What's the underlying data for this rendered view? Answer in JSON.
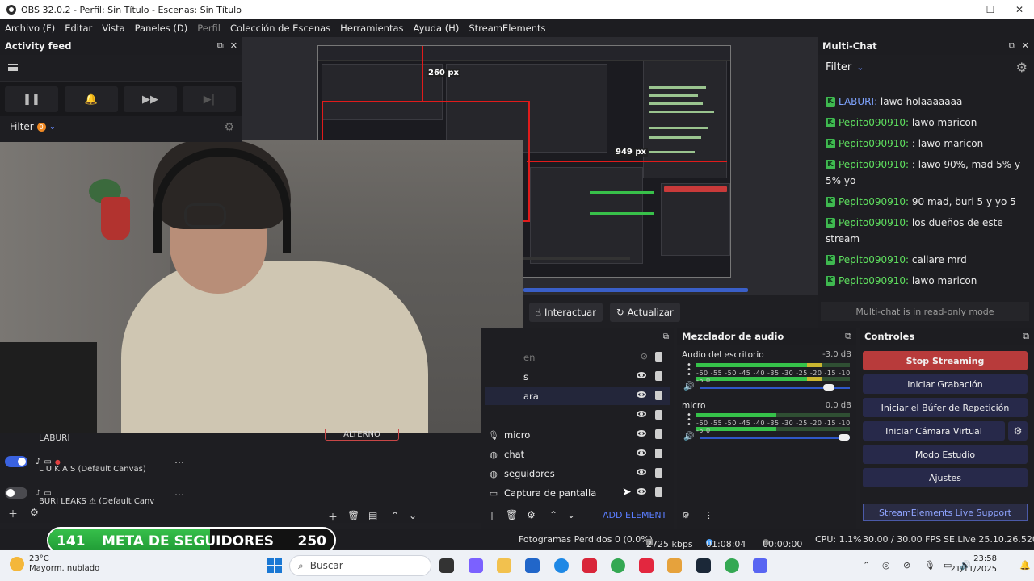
{
  "window": {
    "title": "OBS 32.0.2 - Perfil: Sin Título - Escenas: Sin Título"
  },
  "menu": [
    "Archivo (F)",
    "Editar",
    "Vista",
    "Paneles (D)",
    "Perfil",
    "Colección de Escenas",
    "Herramientas",
    "Ayuda (H)",
    "StreamElements"
  ],
  "activity_feed": {
    "title": "Activity feed",
    "filter_label": "Filter",
    "filter_count": "0"
  },
  "preview": {
    "height_label": "260 px",
    "width_label": "949 px",
    "interact_label": "Interactuar",
    "refresh_label": "Actualizar"
  },
  "multichat": {
    "title": "Multi-Chat",
    "filter_label": "Filter",
    "readonly_text": "Multi-chat is in read-only mode",
    "messages": [
      {
        "user": "LABURI:",
        "text": " lawo holaaaaaaa"
      },
      {
        "user": "Pepito090910:",
        "text": " lawo maricon"
      },
      {
        "user": "Pepito090910:",
        "text": " : lawo maricon"
      },
      {
        "user": "Pepito090910:",
        "text": " : lawo 90%, mad 5% y 5% yo"
      },
      {
        "user": "Pepito090910:",
        "text": " 90 mad, buri 5 y yo 5"
      },
      {
        "user": "Pepito090910:",
        "text": " los dueños de este stream"
      },
      {
        "user": "Pepito090910:",
        "text": " callare mrd"
      },
      {
        "user": "Pepito090910:",
        "text": " lawo maricon"
      }
    ]
  },
  "sources": {
    "partial_rows": [
      "en",
      "s",
      "ara"
    ],
    "items": [
      "micro",
      "chat",
      "seguidores",
      "Captura de pantalla"
    ],
    "add_element": "ADD ELEMENT"
  },
  "mixer": {
    "title": "Mezclador de audio",
    "channels": [
      {
        "name": "Audio del escritorio",
        "db": "-3.0 dB",
        "level": 0.82,
        "volume": 0.9
      },
      {
        "name": "micro",
        "db": "0.0 dB",
        "level": 0.52,
        "volume": 1.0
      }
    ],
    "scale": "-60 -55 -50 -45 -40 -35 -30 -25 -20 -15 -10 -5  0"
  },
  "controls": {
    "title": "Controles",
    "buttons": [
      "Stop Streaming",
      "Iniciar Grabación",
      "Iniciar el Búfer de Repetición",
      "Iniciar Cámara Virtual",
      "Modo Estudio",
      "Ajustes"
    ],
    "support": "StreamElements Live Support"
  },
  "scenes": {
    "items": [
      {
        "name": "LABURI",
        "on": true
      },
      {
        "name": "L U K A S  (Default Canvas)",
        "on": true
      },
      {
        "name": "BURI LEAKS ⚠ (Default Canv",
        "on": false
      }
    ]
  },
  "transition": {
    "label": "ALTERNO"
  },
  "goal": {
    "current": "141",
    "label": "META DE SEGUIDORES",
    "target": "250",
    "progress": 0.564
  },
  "status": {
    "dropped": "Fotogramas Perdidos 0 (0.0%)",
    "bitrate": "2725 kbps",
    "live_time": "01:08:04",
    "rec_time": "00:00:00",
    "cpu": "CPU: 1.1%",
    "fps": "30.00 / 30.00 FPS",
    "se_version": "SE.Live 25.10.26.520"
  },
  "taskbar": {
    "temp": "23°C",
    "weather": "Mayorm. nublado",
    "search_placeholder": "Buscar",
    "time": "23:58",
    "date": "21/11/2025"
  },
  "colors": {
    "accent": "#3a62e0",
    "stop": "#b83b3b",
    "chat_user": "#5fe05f",
    "goal_fill": "#2fb444"
  }
}
